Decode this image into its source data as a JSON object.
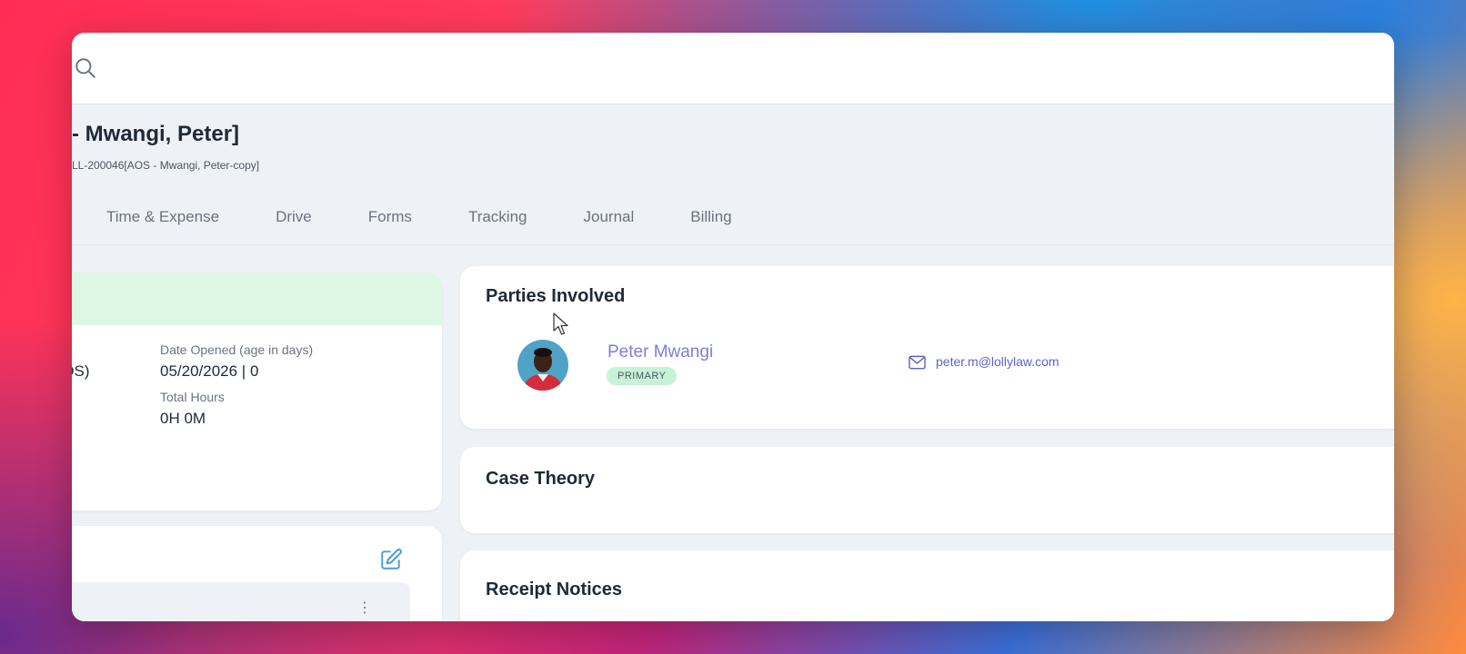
{
  "matter": {
    "title": "- Mwangi, Peter]",
    "subtitle": "LL-200046[AOS - Mwangi, Peter-copy]"
  },
  "tabs": [
    {
      "label": "Time & Expense"
    },
    {
      "label": "Drive"
    },
    {
      "label": "Forms"
    },
    {
      "label": "Tracking"
    },
    {
      "label": "Journal"
    },
    {
      "label": "Billing"
    }
  ],
  "summary": {
    "case_type_value": "AOS)",
    "date_opened_label": "Date Opened (age in days)",
    "date_opened_value": "05/20/2026 | 0",
    "total_hours_label": "Total Hours",
    "total_hours_value": "0H 0M"
  },
  "parties": {
    "title": "Parties Involved",
    "party": {
      "name": "Peter Mwangi",
      "badge": "PRIMARY",
      "email": "peter.m@lollylaw.com"
    }
  },
  "case_theory": {
    "title": "Case Theory"
  },
  "receipt_notices": {
    "title": "Receipt Notices"
  },
  "colors": {
    "accent_name": "#7b7fd6",
    "email": "#5a63c9",
    "badge_bg": "#c7f2d6",
    "summary_head": "#dcf7e4"
  },
  "icons": {
    "search": "search-icon",
    "edit": "edit-icon",
    "mail": "mail-icon",
    "more": "more-vertical-icon"
  }
}
